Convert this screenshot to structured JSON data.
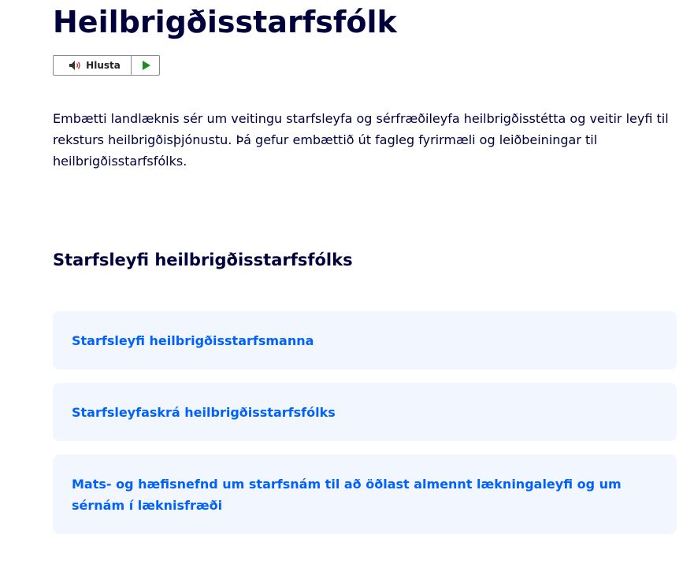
{
  "page": {
    "title": "Heilbrigðisstarfsfólk",
    "intro": "Embætti landlæknis sér um veitingu starfsleyfa og sérfræðileyfa heilbrigðisstétta og veitir leyfi til reksturs heilbrigðisþjónustu. Þá gefur embættið út fagleg fyrirmæli og leiðbeiningar til heilbrigðisstarfsfólks."
  },
  "listen": {
    "label": "Hlusta",
    "icon": "speaker-icon",
    "play_icon": "play-icon",
    "play_color": "#1f8a1f"
  },
  "section": {
    "heading": "Starfsleyfi heilbrigðisstarfsfólks",
    "cards": [
      {
        "label": "Starfsleyfi heilbrigðisstarfsmanna"
      },
      {
        "label": "Starfsleyfaskrá heilbrigðisstarfsfólks"
      },
      {
        "label": "Mats- og hæfisnefnd um starfsnám til að öðlast almennt lækningaleyfi og um sérnám í læknisfræði"
      }
    ]
  },
  "colors": {
    "text": "#00003c",
    "link": "#0061ff",
    "card_background": "#f2f7ff"
  }
}
